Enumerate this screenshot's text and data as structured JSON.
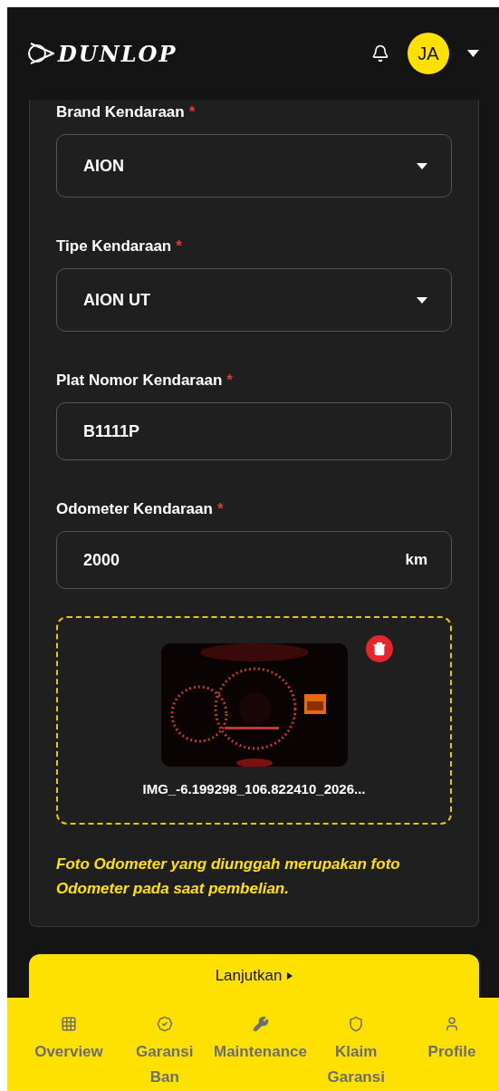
{
  "header": {
    "brand": "DUNLOP",
    "avatar": "JA"
  },
  "fields": [
    {
      "kind": "select",
      "label": "Brand Kendaraan",
      "required_mark": "*",
      "value": "AION"
    },
    {
      "kind": "select",
      "label": "Tipe Kendaraan",
      "required_mark": "*",
      "value": "AION UT"
    },
    {
      "kind": "text",
      "label": "Plat Nomor Kendaraan",
      "required_mark": "*",
      "value": "B1111P"
    },
    {
      "kind": "unit",
      "label": "Odometer Kendaraan",
      "required_mark": "*",
      "value": "2000",
      "unit": "km"
    }
  ],
  "upload": {
    "filename": "IMG_-6.199298_106.822410_2026..."
  },
  "note": "Foto Odometer yang diunggah merupakan foto Odometer pada saat pembelian.",
  "continue_button": "Lanjutkan",
  "bottom_nav": [
    {
      "label": "Overview"
    },
    {
      "label": "Garansi Ban"
    },
    {
      "label": "Maintenance"
    },
    {
      "label": "Klaim Garansi"
    },
    {
      "label": "Profile"
    }
  ]
}
